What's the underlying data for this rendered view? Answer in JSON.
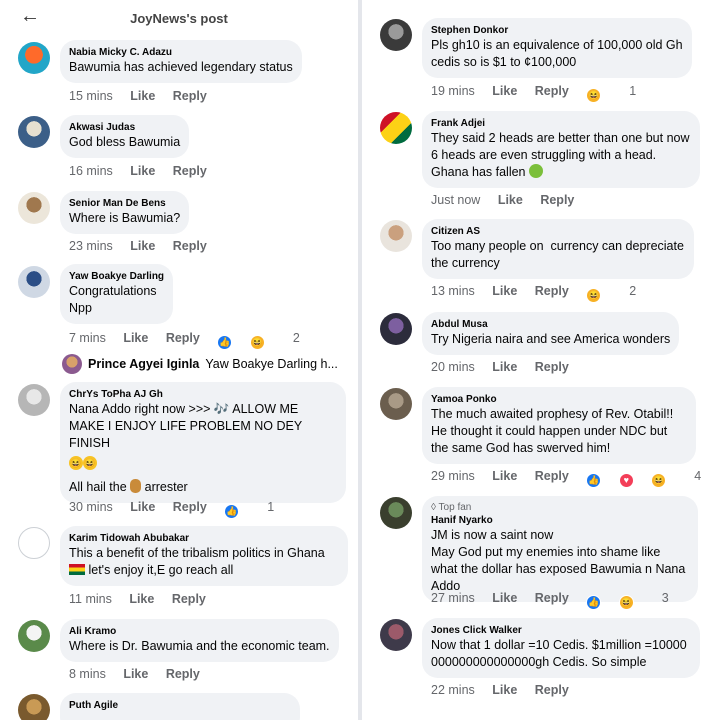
{
  "header": {
    "back_icon": "arrow-left-icon",
    "title": "JoyNews's post"
  },
  "labels": {
    "like": "Like",
    "reply": "Reply",
    "top_fan": "Top fan"
  },
  "left_comments": [
    {
      "name": "Nabia Micky C. Adazu",
      "text": "Bawumia has achieved legendary status",
      "time": "15 mins",
      "reactions": [],
      "count": ""
    },
    {
      "name": "Akwasi Judas",
      "text": "God bless Bawumia",
      "time": "16 mins",
      "reactions": [],
      "count": ""
    },
    {
      "name": "Senior Man De Bens",
      "text": "Where is Bawumia?",
      "time": "23 mins",
      "reactions": [],
      "count": ""
    },
    {
      "name": "Yaw Boakye Darling",
      "text": "Congratulations\nNpp",
      "time": "7 mins",
      "reactions": [
        "like",
        "haha"
      ],
      "count": "2"
    },
    {
      "name": "ChrYs ToPha AJ Gh",
      "text": "Nana Addo right now >>> 🎶 ALLOW ME MAKE I ENJOY LIFE PROBLEM NO DEY FINISH",
      "text2": "All hail the",
      "text3": "arrester",
      "time": "30 mins",
      "reactions": [
        "like"
      ],
      "count": "1"
    },
    {
      "name": "Karim Tidowah Abubakar",
      "text": "This a benefit of the tribalism politics in Ghana",
      "text2": "let's enjoy it,E go reach all",
      "time": "11 mins",
      "reactions": [],
      "count": ""
    },
    {
      "name": "Ali Kramo",
      "text": "Where is Dr. Bawumia and the economic team.",
      "time": "8 mins",
      "reactions": [],
      "count": ""
    },
    {
      "name": "Puth Agile",
      "text": "",
      "time": "",
      "reactions": [],
      "count": ""
    }
  ],
  "reply_preview": {
    "name": "Prince Agyei Iginla",
    "text": "Yaw Boakye Darling h..."
  },
  "right_comments": [
    {
      "name": "Stephen Donkor",
      "text": "Pls gh10 is an equivalence of 100,000 old Gh cedis so is $1 to ¢100,000",
      "time": "19 mins",
      "reactions": [
        "haha"
      ],
      "count": "1"
    },
    {
      "name": "Frank Adjei",
      "text": "They said 2 heads are better than one but now 6 heads are even struggling with a head. Ghana has fallen",
      "time": "Just now",
      "reactions": [],
      "count": ""
    },
    {
      "name": "Citizen AS",
      "text": "Too many people on  currency can depreciate the currency",
      "time": "13 mins",
      "reactions": [
        "haha"
      ],
      "count": "2"
    },
    {
      "name": "Abdul Musa",
      "text": "Try Nigeria naira and see America wonders",
      "time": "20 mins",
      "reactions": [],
      "count": ""
    },
    {
      "name": "Yamoa Ponko",
      "text": "The much awaited prophesy of Rev. Otabil!! He thought it could happen under NDC but the same God has swerved him!",
      "time": "29 mins",
      "reactions": [
        "like",
        "love",
        "haha"
      ],
      "count": "4"
    },
    {
      "name": "Hanif Nyarko",
      "text": "JM is now a saint now\nMay God put my enemies into shame like what the dollar has exposed Bawumia n Nana Addo",
      "time": "27 mins",
      "reactions": [
        "like",
        "haha"
      ],
      "count": "3",
      "top_fan": true
    },
    {
      "name": "Jones Click Walker",
      "text": "Now that 1 dollar =10 Cedis. $1million =10000000000000000000gh Cedis. So simple",
      "time": "22 mins",
      "reactions": [],
      "count": ""
    }
  ],
  "colors": {
    "bubble": "#f0f2f5",
    "meta": "#65676b",
    "like": "#1877f2",
    "haha": "#f7b125",
    "love": "#f33e58"
  }
}
